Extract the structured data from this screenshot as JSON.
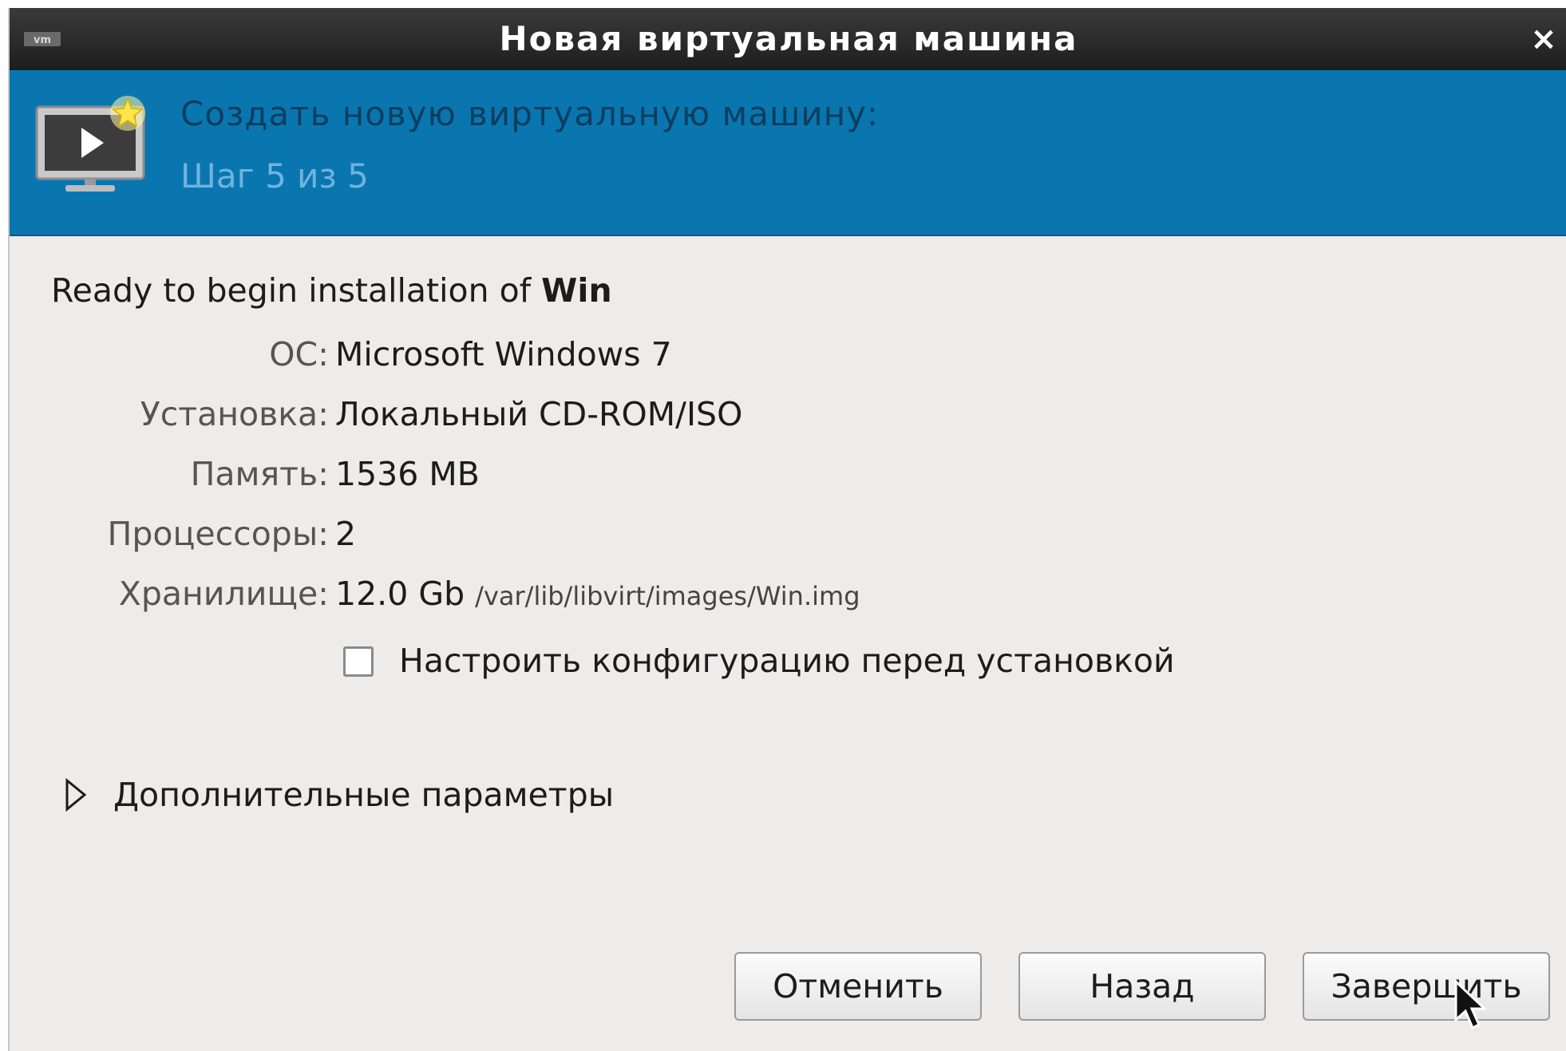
{
  "window": {
    "title": "Новая виртуальная машина",
    "close_glyph": "×"
  },
  "banner": {
    "heading": "Создать новую виртуальную машину:",
    "step": "Шаг 5 из 5",
    "icon": "vm-monitor-new-icon"
  },
  "summary": {
    "ready_prefix": "Ready to begin installation of ",
    "vm_name": "Win",
    "rows": [
      {
        "label": "ОС:",
        "value": "Microsoft Windows 7"
      },
      {
        "label": "Установка:",
        "value": "Локальный CD-ROM/ISO"
      },
      {
        "label": "Память:",
        "value": "1536 MB"
      },
      {
        "label": "Процессоры:",
        "value": "2"
      },
      {
        "label": "Хранилище:",
        "value": "12.0 Gb",
        "path": "/var/lib/libvirt/images/Win.img"
      }
    ]
  },
  "customize_checkbox": {
    "label": "Настроить конфигурацию перед установкой",
    "checked": false
  },
  "advanced": {
    "label": "Дополнительные параметры",
    "expanded": false
  },
  "buttons": {
    "cancel": "Отменить",
    "back": "Назад",
    "finish": "Завершить"
  },
  "colors": {
    "banner": "#0a76b0",
    "titlebar": "#2a2a2a",
    "dialog_bg": "#edeceb"
  }
}
